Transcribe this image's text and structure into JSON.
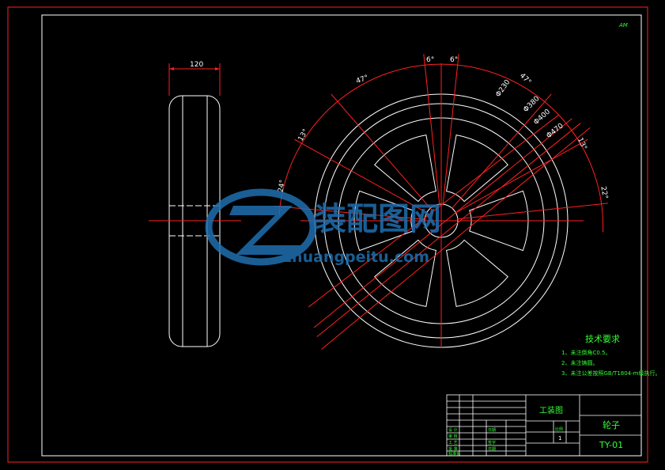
{
  "corner_tag": "AM",
  "side_view": {
    "width_dim": "120"
  },
  "front_view": {
    "angles": {
      "top_left": "6°",
      "top_right": "6°",
      "upper_left": "47°",
      "upper_right": "47°",
      "left_upper": "13°",
      "right_upper": "13°",
      "left": "24°",
      "right": "22°"
    },
    "diameters": [
      "Φ230",
      "Φ380",
      "Φ400",
      "Φ470"
    ]
  },
  "watermark": {
    "cn": "装配图网",
    "url": "zhuangpeitu.com"
  },
  "tech_requirements": {
    "title": "技术要求",
    "items": [
      "1、未注倒角C0.5。",
      "2、未注铸圆。",
      "3、未注公差按照GB/T1804-m级执行。"
    ]
  },
  "title_block": {
    "center_label": "工装图",
    "part_name": "轮子",
    "drawing_no": "TY-01",
    "quantity": "1",
    "scale_label": "比例",
    "row_labels": [
      "设 计",
      "审 核",
      "工 艺",
      "批 准",
      "标准化"
    ],
    "mid_labels": [
      "日期",
      "签字",
      "日期"
    ]
  },
  "colors": {
    "background": "#000000",
    "border": "#ff2020",
    "geometry": "#ffffff",
    "dimension": "#ff2020",
    "notes": "#33ff33",
    "watermark": "#1f6fb0"
  }
}
